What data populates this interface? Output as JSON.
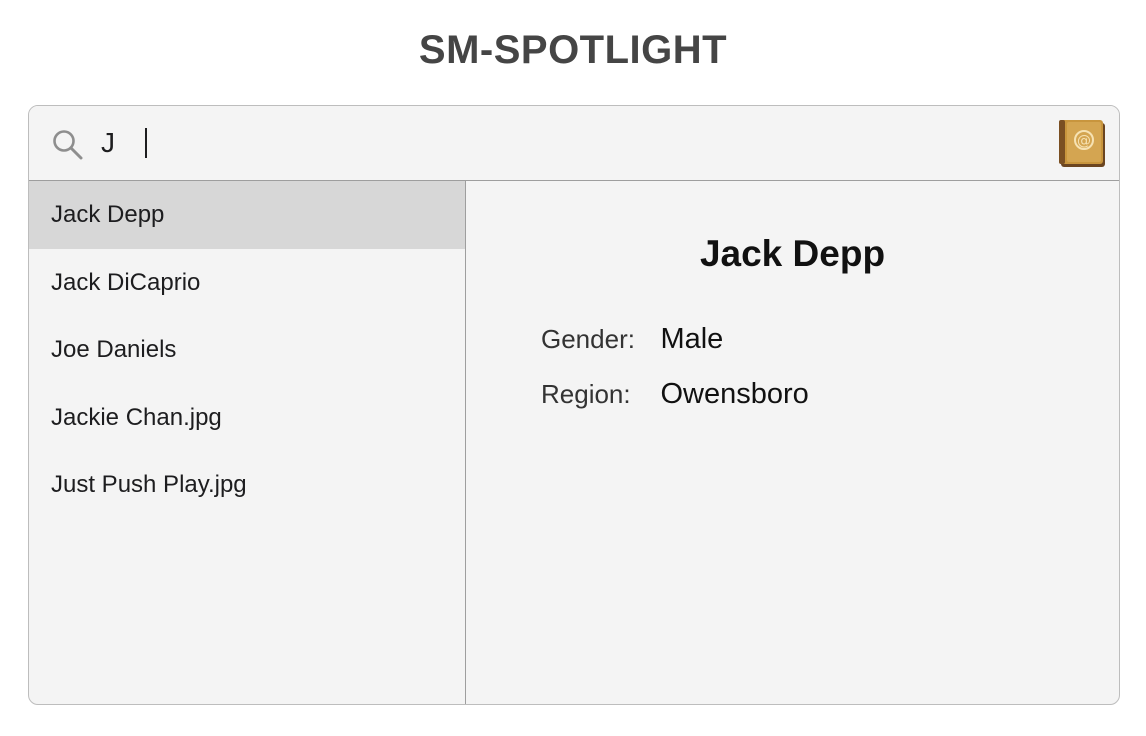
{
  "app": {
    "title": "SM-SPOTLIGHT"
  },
  "search": {
    "value": "J",
    "search_icon": "search-icon",
    "contacts_icon": "address-book-icon"
  },
  "results": [
    {
      "label": "Jack Depp",
      "selected": true
    },
    {
      "label": "Jack DiCaprio",
      "selected": false
    },
    {
      "label": "Joe Daniels",
      "selected": false
    },
    {
      "label": "Jackie Chan.jpg",
      "selected": false
    },
    {
      "label": "Just Push Play.jpg",
      "selected": false
    }
  ],
  "detail": {
    "name": "Jack Depp",
    "fields": [
      {
        "label": "Gender:",
        "value": "Male"
      },
      {
        "label": "Region:",
        "value": "Owensboro"
      }
    ]
  },
  "colors": {
    "selected_row": "#d7d7d7",
    "window_bg": "#f4f4f4",
    "book_cover": "#c8953d"
  }
}
